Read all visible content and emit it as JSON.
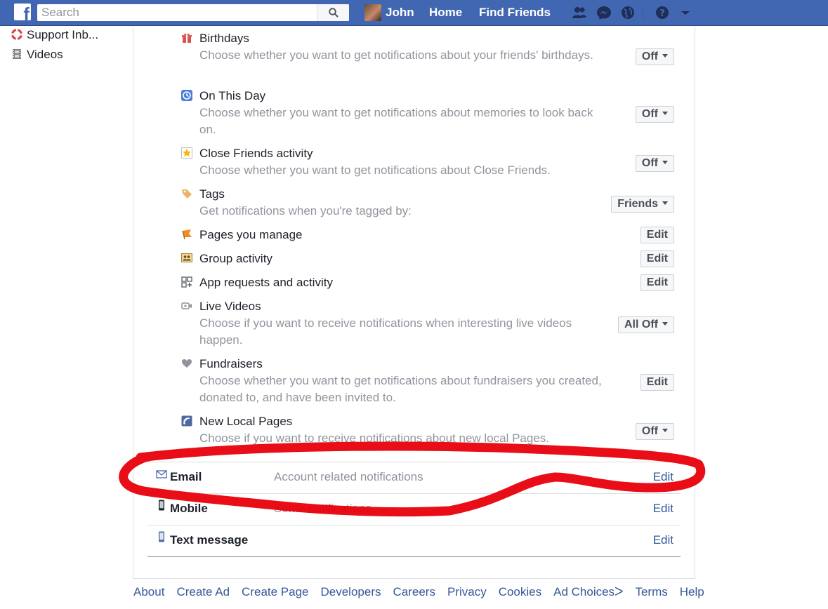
{
  "topbar": {
    "search_placeholder": "Search",
    "user_name": "John",
    "home_label": "Home",
    "find_friends_label": "Find Friends",
    "icons": [
      "friend-requests-icon",
      "messenger-icon",
      "globe-notifications-icon",
      "help-icon",
      "account-menu-arrow-icon"
    ]
  },
  "sidebar": {
    "items": [
      {
        "label": "Support Inb...",
        "icon": "support-lifebuoy-icon"
      },
      {
        "label": "Videos",
        "icon": "film-icon"
      }
    ]
  },
  "settings": [
    {
      "title": "Birthdays",
      "desc": "Choose whether you want to get notifications about your friends' birthdays.",
      "control": "Off",
      "icon": "gift-icon"
    },
    {
      "title": "On This Day",
      "desc": "Choose whether you want to get notifications about memories to look back on.",
      "control": "Off",
      "icon": "memories-clock-icon"
    },
    {
      "title": "Close Friends activity",
      "desc": "Choose whether you want to get notifications about Close Friends.",
      "control": "Off",
      "icon": "star-icon"
    },
    {
      "title": "Tags",
      "desc": "Get notifications when you're tagged by:",
      "control": "Friends",
      "icon": "tag-icon"
    },
    {
      "title": "Pages you manage",
      "desc": "",
      "control": "Edit",
      "icon": "flag-icon"
    },
    {
      "title": "Group activity",
      "desc": "",
      "control": "Edit",
      "icon": "group-icon"
    },
    {
      "title": "App requests and activity",
      "desc": "",
      "control": "Edit",
      "icon": "apps-icon"
    },
    {
      "title": "Live Videos",
      "desc": "Choose if you want to receive notifications when interesting live videos happen.",
      "control": "All Off",
      "icon": "video-camera-icon"
    },
    {
      "title": "Fundraisers",
      "desc": "Choose whether you want to get notifications about fundraisers you created, donated to, and have been invited to.",
      "control": "Edit",
      "icon": "heart-icon"
    },
    {
      "title": "New Local Pages",
      "desc": "Choose if you want to receive notifications about new local Pages.",
      "control": "Off",
      "icon": "local-pages-icon"
    }
  ],
  "channels": [
    {
      "title": "Email",
      "desc": "Account related notifications",
      "edit": "Edit",
      "icon": "envelope-icon"
    },
    {
      "title": "Mobile",
      "desc": "Some notifications",
      "edit": "Edit",
      "icon": "mobile-phone-icon"
    },
    {
      "title": "Text message",
      "desc": "",
      "edit": "Edit",
      "icon": "sms-phone-icon"
    }
  ],
  "footer": {
    "links": [
      "About",
      "Create Ad",
      "Create Page",
      "Developers",
      "Careers",
      "Privacy",
      "Cookies",
      "Ad Choicesᐳ",
      "Terms",
      "Help"
    ]
  },
  "colors": {
    "brand_blue": "#4267b2",
    "link_blue": "#365899",
    "muted_text": "#90949c",
    "annotation_red": "#e8000b"
  }
}
